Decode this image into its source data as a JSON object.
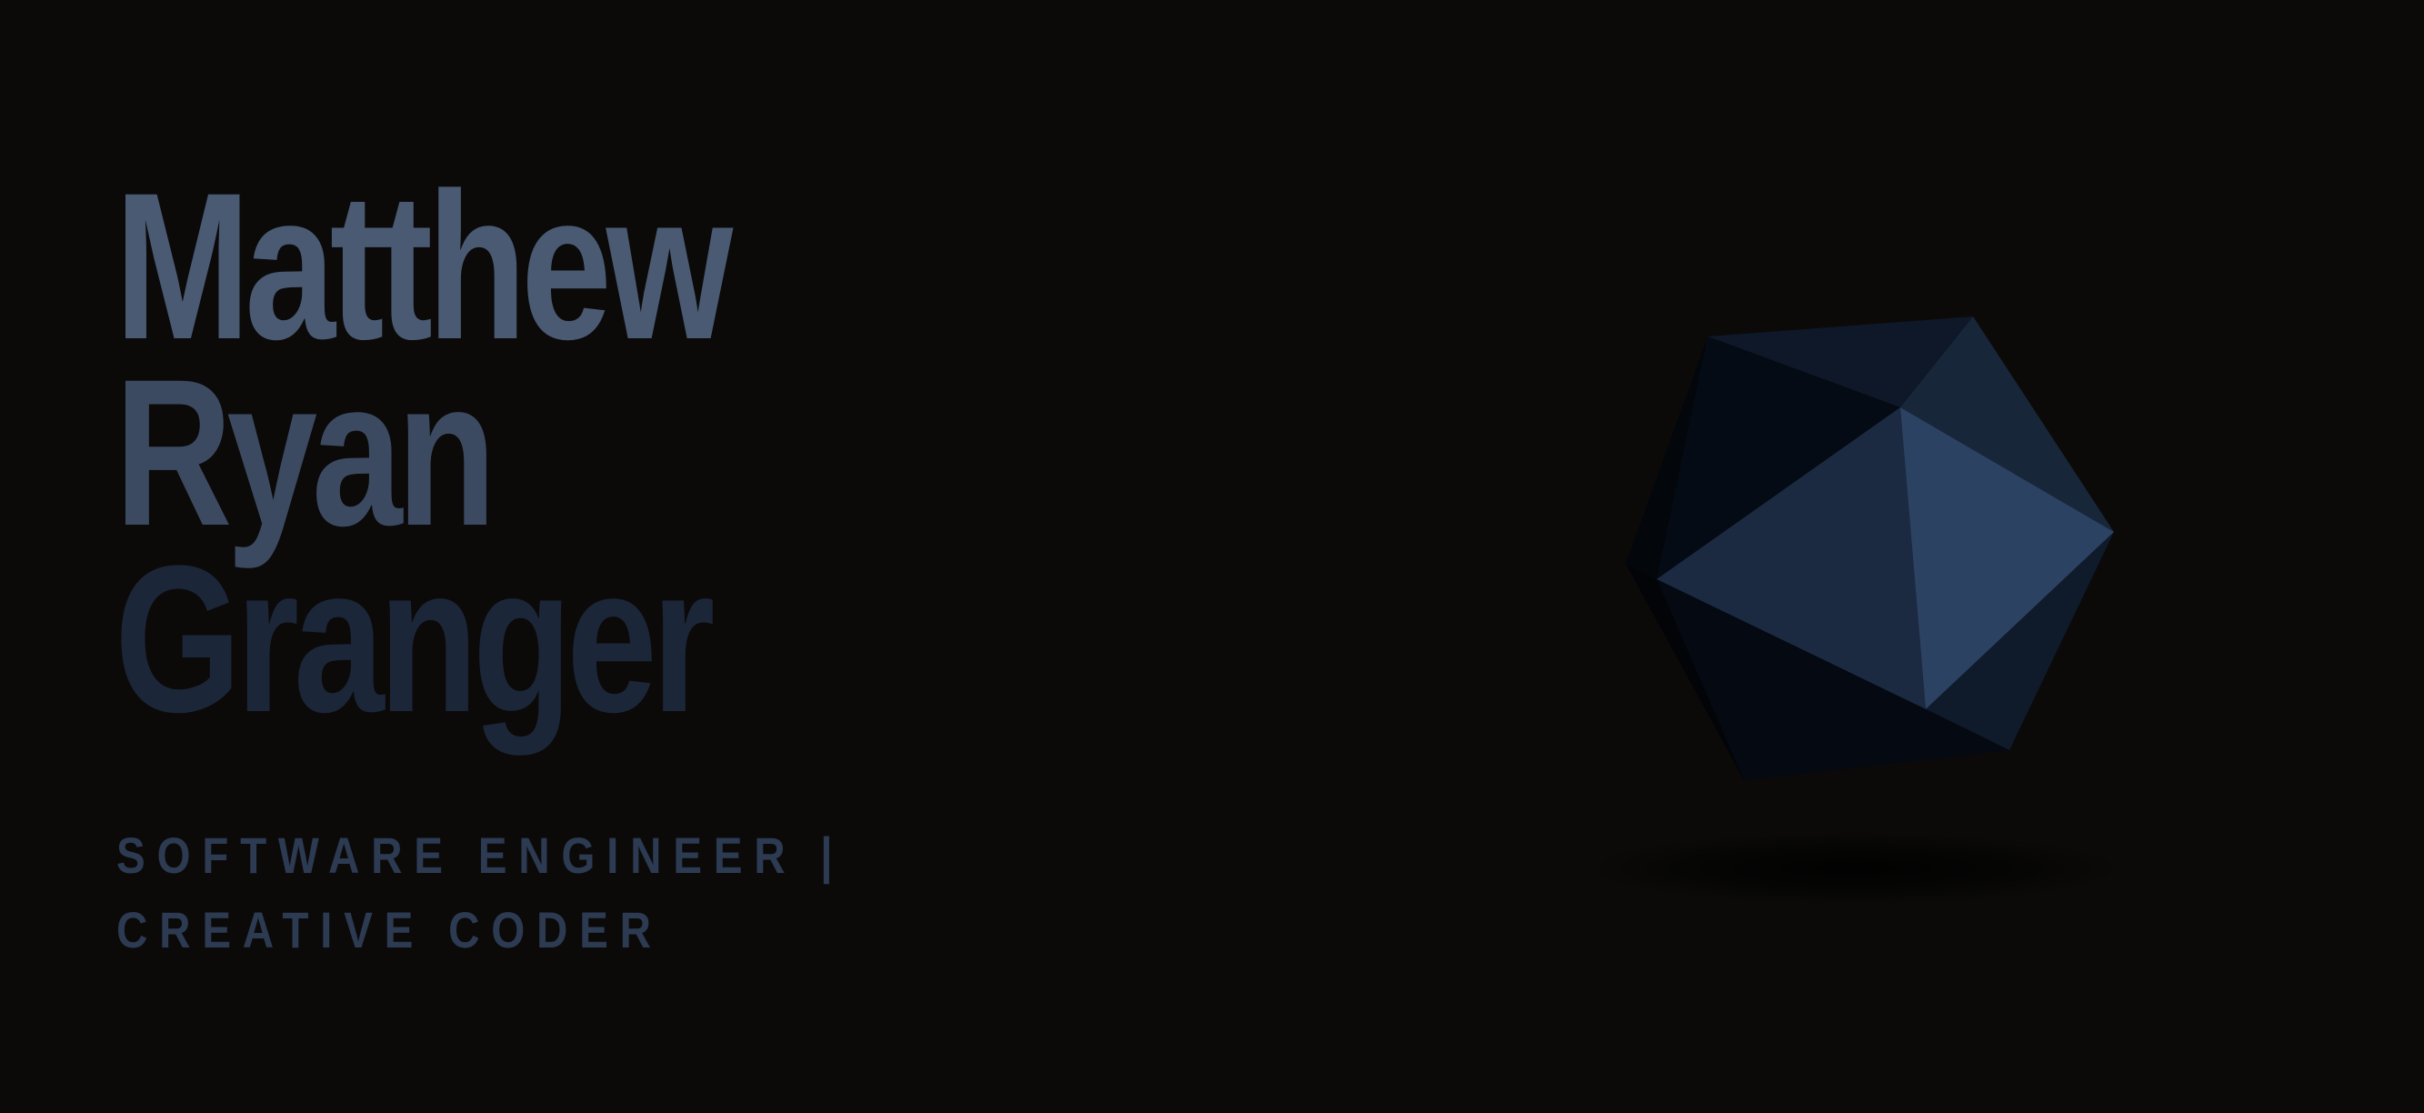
{
  "hero": {
    "name_lines": [
      "Matthew",
      "Ryan",
      "Granger"
    ],
    "tagline": "SOFTWARE ENGINEER | CREATIVE CODER"
  },
  "decor": {
    "shape_icon": "icosahedron-icon",
    "colors": {
      "background": "#0b0a09",
      "name_top": "#4a5a73",
      "name_bottom": "#1c2639",
      "tagline": "#2c3a52",
      "facet_light": "#2c4262",
      "facet_mid": "#1b2a40",
      "facet_dark": "#050b14"
    }
  }
}
